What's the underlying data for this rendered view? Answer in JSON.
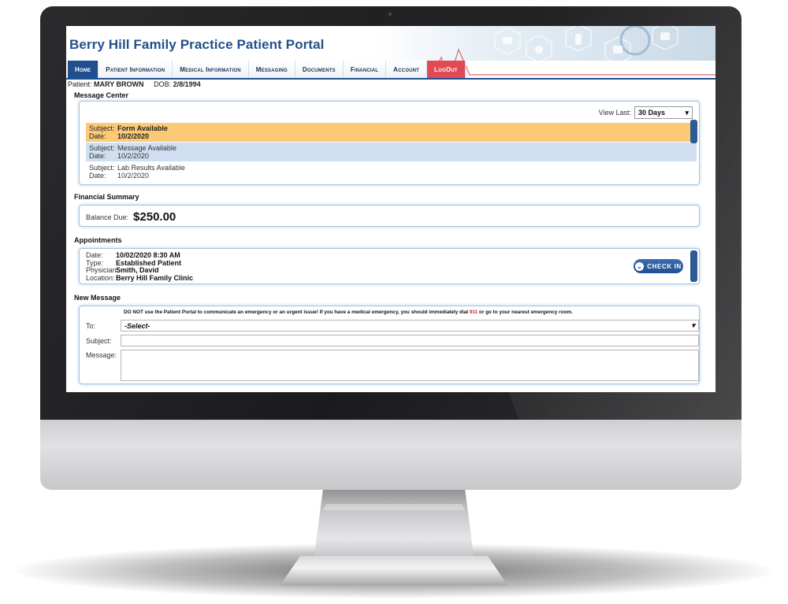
{
  "portal": {
    "title": "Berry Hill Family Practice Patient Portal"
  },
  "nav": {
    "items": [
      {
        "label": "Home"
      },
      {
        "label": "Patient Information"
      },
      {
        "label": "Medical Information"
      },
      {
        "label": "Messaging"
      },
      {
        "label": "Documents"
      },
      {
        "label": "Financial"
      },
      {
        "label": "Account"
      },
      {
        "label": "LogOut"
      }
    ]
  },
  "patient": {
    "label": "Patient:",
    "name": "MARY BROWN",
    "dob_label": "DOB:",
    "dob": "2/8/1994"
  },
  "message_center": {
    "title": "Message Center",
    "view_last_label": "View Last:",
    "view_last_value": "30 Days",
    "subject_label": "Subject:",
    "date_label": "Date:",
    "messages": [
      {
        "subject": "Form Available",
        "date": "10/2/2020"
      },
      {
        "subject": "Message Available",
        "date": "10/2/2020"
      },
      {
        "subject": "Lab Results Available",
        "date": "10/2/2020"
      }
    ]
  },
  "financial": {
    "title": "Financial Summary",
    "balance_label": "Balance Due:",
    "balance_value": "$250.00"
  },
  "appointments": {
    "title": "Appointments",
    "date_label": "Date:",
    "date": "10/02/2020 8:30 AM",
    "type_label": "Type:",
    "type": "Established Patient",
    "physician_label": "Physician:",
    "physician": "Smith, David",
    "location_label": "Location:",
    "location": "Berry Hill Family Clinic",
    "checkin_label": "CHECK IN"
  },
  "new_message": {
    "title": "New Message",
    "warning_pre": "DO NOT use the Patient Portal to communicate an emergency or an urgent issue! If you have a medical emergency, you should immediately dial",
    "warning_num": "911",
    "warning_post": "or go to your nearest emergency room.",
    "to_label": "To:",
    "to_value": "-Select-",
    "subject_label": "Subject:",
    "message_label": "Message:"
  },
  "colors": {
    "brand_blue": "#1f4f8f",
    "logout_red": "#e04a55",
    "highlight_orange": "#fcc976",
    "highlight_blue": "#cfdff1"
  }
}
